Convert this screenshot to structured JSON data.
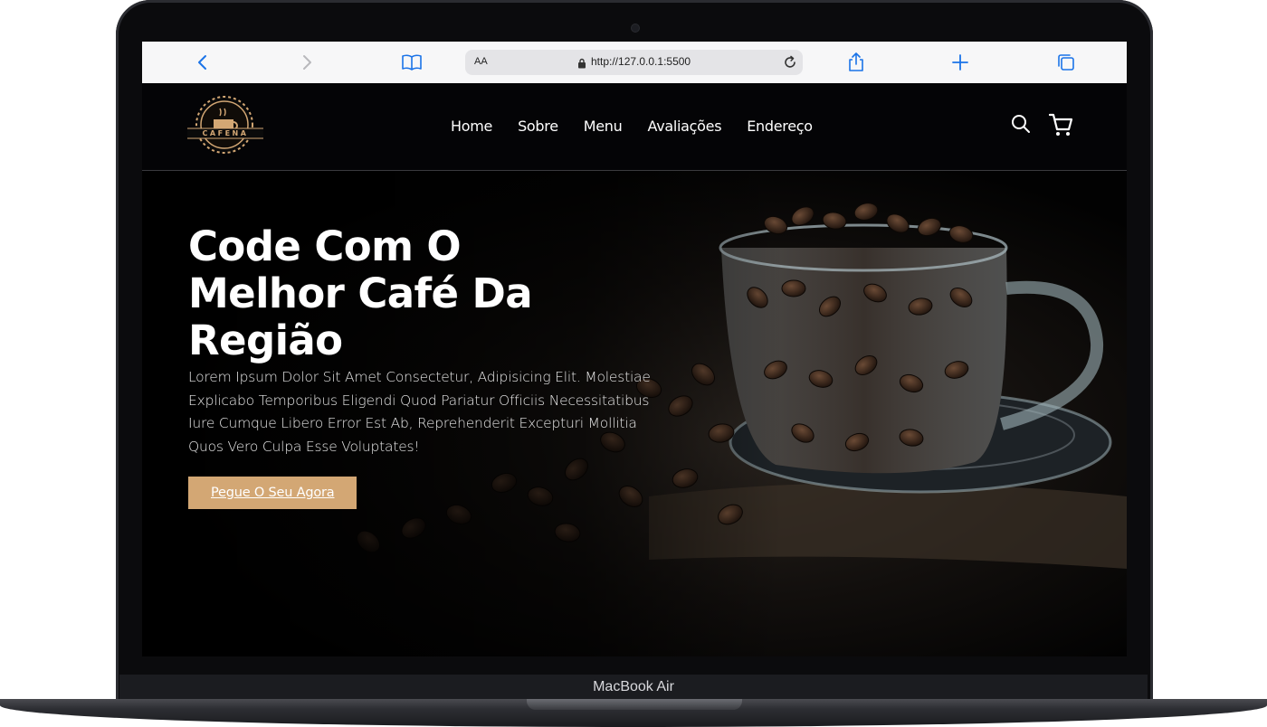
{
  "device": {
    "label": "MacBook Air"
  },
  "browser": {
    "aa_label": "AA",
    "url": "http://127.0.0.1:5500",
    "icons": [
      "back-icon",
      "forward-icon",
      "bookmarks-icon",
      "lock-icon",
      "reload-icon",
      "share-icon",
      "new-tab-icon",
      "tabs-icon"
    ]
  },
  "site": {
    "logo_text": "CAFENA",
    "nav": [
      "Home",
      "Sobre",
      "Menu",
      "Avaliações",
      "Endereço"
    ],
    "header_icons": [
      "search-icon",
      "cart-icon"
    ],
    "hero": {
      "title_lines": [
        "Code Com O",
        "Melhor Café Da",
        "Região"
      ],
      "text": "Lorem Ipsum Dolor Sit Amet Consectetur, Adipisicing Elit. Molestiae Explicabo Temporibus Eligendi Quod Pariatur Officiis Necessitatibus Iure Cumque Libero Error Est Ab, Reprehenderit Excepturi Mollitia Quos Vero Culpa Esse Voluptates!",
      "button": "Pegue O Seu Agora"
    },
    "colors": {
      "accent": "#d3a774",
      "background": "#050507",
      "text": "#ffffff"
    }
  }
}
